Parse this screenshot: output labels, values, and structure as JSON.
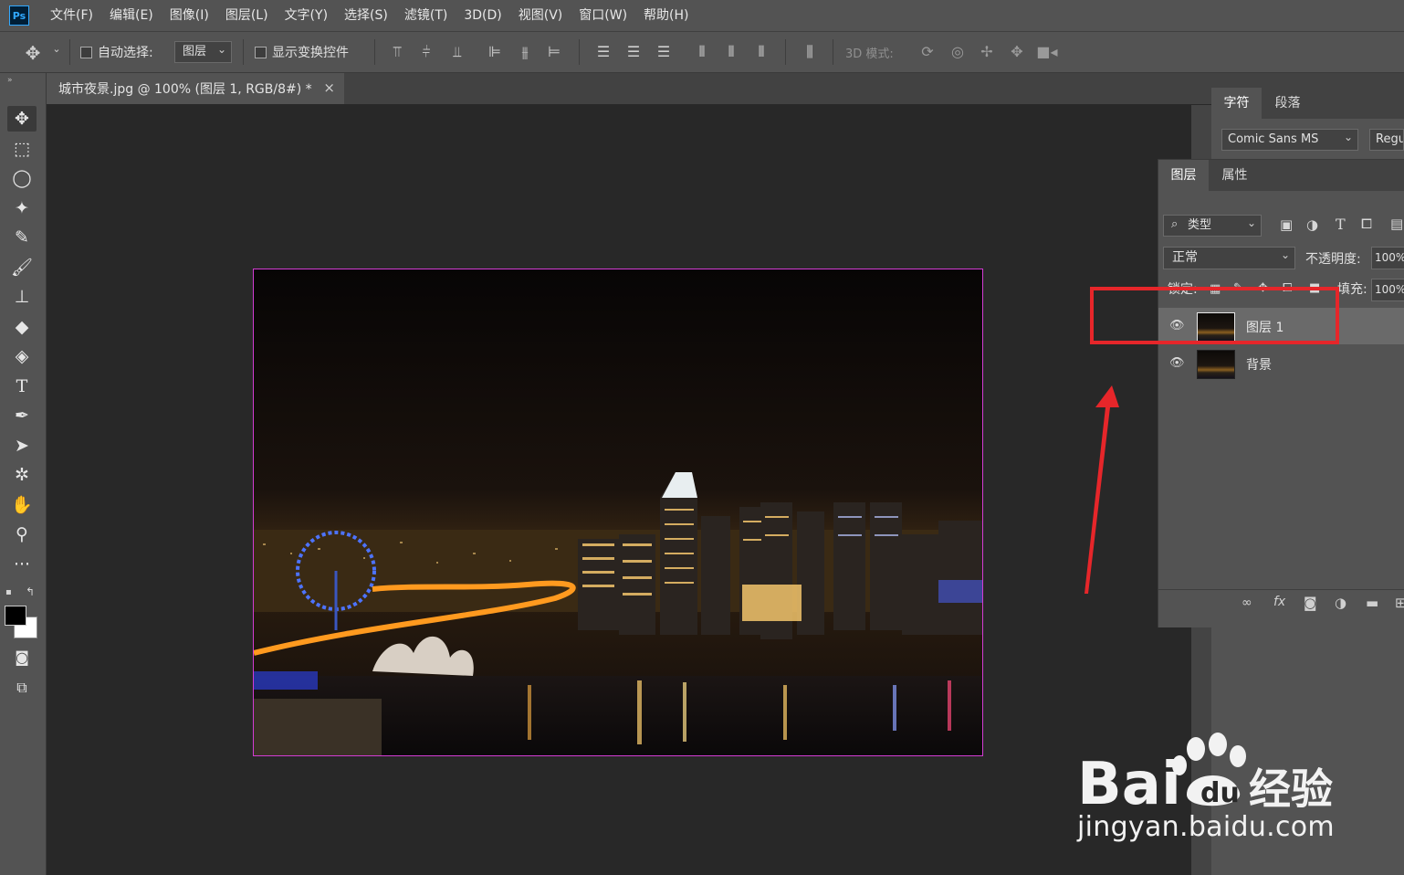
{
  "app": {
    "logo": "Ps"
  },
  "menu": [
    "文件(F)",
    "编辑(E)",
    "图像(I)",
    "图层(L)",
    "文字(Y)",
    "选择(S)",
    "滤镜(T)",
    "3D(D)",
    "视图(V)",
    "窗口(W)",
    "帮助(H)"
  ],
  "options": {
    "auto_select_label": "自动选择:",
    "auto_select_value": "图层",
    "show_transform_label": "显示变换控件",
    "mode_3d_label": "3D 模式:"
  },
  "document": {
    "tab_title": "城市夜景.jpg @ 100% (图层 1, RGB/8#) *",
    "close_glyph": "×"
  },
  "char_panel": {
    "tabs": [
      "字符",
      "段落"
    ],
    "font_family": "Comic Sans MS",
    "font_style": "Regul"
  },
  "layers_panel": {
    "tabs": [
      "图层",
      "属性"
    ],
    "filter_kind": "类型",
    "blend_mode": "正常",
    "opacity_label": "不透明度:",
    "opacity_value": "100%",
    "lock_label": "锁定:",
    "fill_label": "填充:",
    "fill_value": "100%",
    "layers": [
      {
        "name": "图层 1",
        "selected": true
      },
      {
        "name": "背景",
        "selected": false
      }
    ]
  },
  "colors": {
    "accent": "#31a8ff",
    "highlight": "#e6262a",
    "canvas_border": "#d33cd3"
  },
  "watermark": {
    "brand": "Bai",
    "brand_cn": "经验",
    "url": "jingyan.baidu.com"
  }
}
